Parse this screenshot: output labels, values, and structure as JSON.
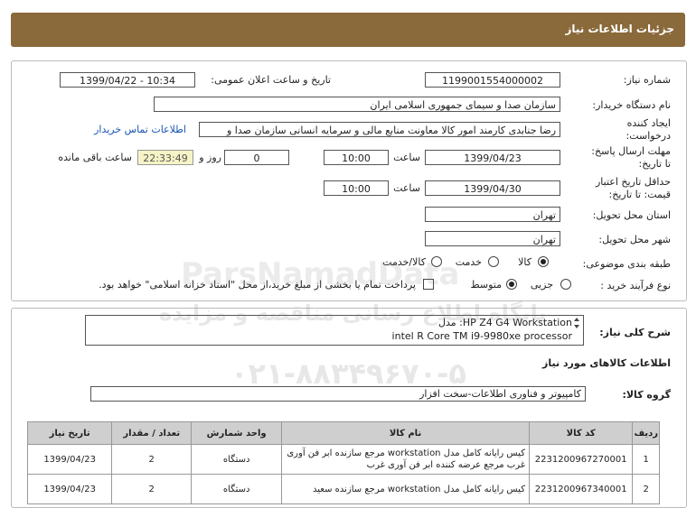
{
  "header": {
    "title": "جزئیات اطلاعات نیاز"
  },
  "form": {
    "need_number_label": "شماره نیاز:",
    "need_number": "1199001554000002",
    "announce_label": "تاریخ و ساعت اعلان عمومی:",
    "announce_value": "1399/04/22 - 10:34",
    "buyer_label": "نام دستگاه خریدار:",
    "buyer_value": "سازمان صدا و سیمای جمهوری اسلامی ایران",
    "creator_label_1": "ایجاد کننده",
    "creator_label_2": "درخواست:",
    "creator_value": "رضا جنابدی کارمند امور کالا معاونت منابع مالی و سرمایه انسانی سازمان صدا و",
    "contact_link": "اطلاعات تماس خریدار",
    "deadline_label_1": "مهلت ارسال پاسخ:",
    "deadline_label_2": "تا تاریخ:",
    "deadline_date": "1399/04/23",
    "time_label": "ساعت",
    "deadline_time": "10:00",
    "days_value": "0",
    "days_label": "روز و",
    "timer_value": "22:33:49",
    "remaining_label": "ساعت باقی مانده",
    "validity_label_1": "حداقل تاریخ اعتبار",
    "validity_label_2": "قیمت: تا تاریخ:",
    "validity_date": "1399/04/30",
    "validity_time_label": "ساعت",
    "validity_time": "10:00",
    "province_label": "استان محل تحویل:",
    "province_value": "تهران",
    "city_label": "شهر محل تحویل:",
    "city_value": "تهران",
    "category_label": "طبقه بندی موضوعی:",
    "category_goods": "کالا",
    "category_service": "خدمت",
    "category_both": "کالا/خدمت",
    "process_label": "نوع فرآیند خرید :",
    "process_partial": "جزیی",
    "process_medium": "متوسط",
    "payment_note": "پرداخت تمام یا بخشی از مبلغ خرید،از محل \"اسناد خزانه اسلامی\" خواهد بود."
  },
  "summary": {
    "label": "شرح کلی نیاز:",
    "line1": "مدل :HP Z4 G4 Workstation",
    "line2": "intel  R Core TM i9-9980xe processor"
  },
  "goods": {
    "section_title": "اطلاعات کالاهای مورد نیاز",
    "group_label": "گروه کالا:",
    "group_value": "کامپیوتر و فناوری اطلاعات-سخت افزار"
  },
  "table": {
    "headers": [
      "ردیف",
      "کد کالا",
      "نام کالا",
      "واحد شمارش",
      "تعداد / مقدار",
      "تاریخ نیاز"
    ],
    "rows": [
      {
        "idx": "1",
        "code": "2231200967270001",
        "name": "کیس رایانه کامل مدل workstation مرجع سازنده ابر فن آوری غرب مرجع عرضه کننده ابر فن آوری غرب",
        "unit": "دستگاه",
        "qty": "2",
        "date": "1399/04/23"
      },
      {
        "idx": "2",
        "code": "2231200967340001",
        "name": "کیس رایانه کامل مدل workstation مرجع سازنده سعید",
        "unit": "دستگاه",
        "qty": "2",
        "date": "1399/04/23"
      }
    ]
  },
  "watermark": {
    "line1": "ParsNamadData",
    "line2": "پایگاه اطلاع رسانی مناقصه و مزایده",
    "line3": "۰۲۱-۸۸۳۴۹۶۷۰-۵"
  }
}
